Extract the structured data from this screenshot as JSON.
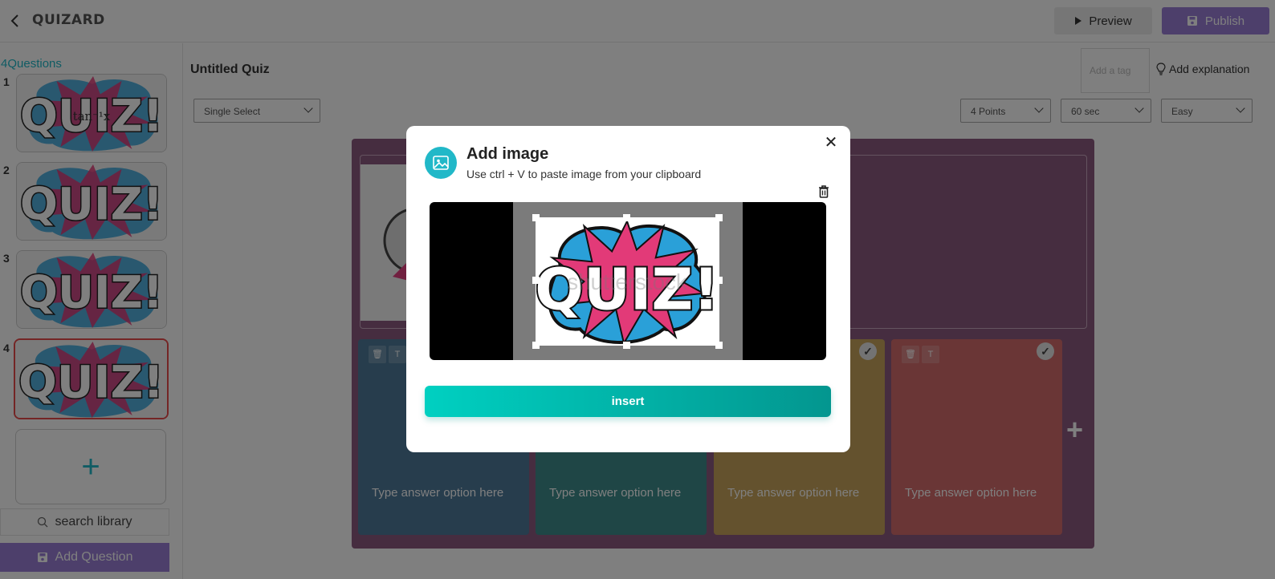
{
  "app": {
    "logo": "QUIZARD",
    "back_icon": "chevron-left-icon"
  },
  "header": {
    "preview_label": "Preview",
    "publish_label": "Publish"
  },
  "sidebar": {
    "count": "4",
    "count_suffix": "Questions",
    "items": [
      {
        "number": "1",
        "thumb_text": "QUIZ!",
        "overlay_text": "tan⁻¹x",
        "selected": false
      },
      {
        "number": "2",
        "thumb_text": "QUIZ!",
        "selected": false
      },
      {
        "number": "3",
        "thumb_text": "QUIZ!",
        "selected": false
      },
      {
        "number": "4",
        "thumb_text": "QUIZ!",
        "selected": true
      }
    ],
    "add_tile_symbol": "+",
    "search_placeholder": "search library",
    "add_question_label": "Add Question"
  },
  "main": {
    "quiz_title": "Untitled Quiz",
    "tag_placeholder": "Add a tag",
    "add_explanation_label": "Add explanation",
    "question_type": "Single Select",
    "points": "4 Points",
    "time": "60 sec",
    "difficulty": "Easy",
    "answers": [
      {
        "placeholder": "Type answer option here",
        "color": "#4f7a9a"
      },
      {
        "placeholder": "Type answer option here",
        "color": "#3f8c8c"
      },
      {
        "placeholder": "Type answer option here",
        "color": "#c8a55c"
      },
      {
        "placeholder": "Type answer option here",
        "color": "#d46d6d"
      }
    ],
    "add_answer_symbol": "+",
    "canvas_color": "#8d5a80"
  },
  "modal": {
    "title": "Add image",
    "subtitle": "Use ctrl + V to paste image from your clipboard",
    "close_symbol": "✕",
    "image_text": "QUIZ!",
    "watermark": "shutterstock",
    "insert_label": "insert"
  }
}
